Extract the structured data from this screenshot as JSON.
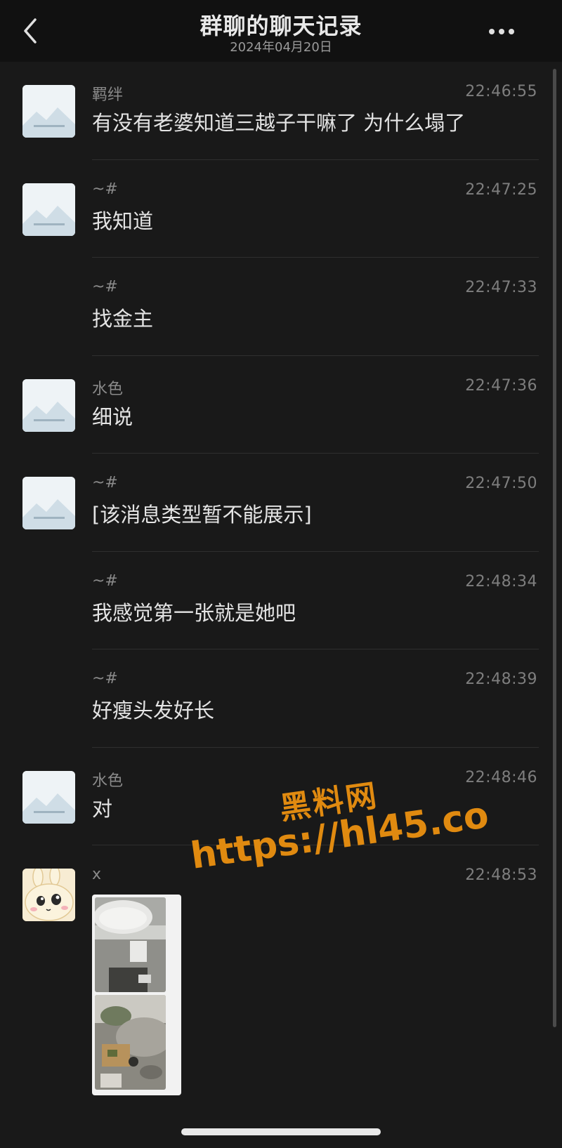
{
  "header": {
    "title": "群聊的聊天记录",
    "date": "2024年04月20日",
    "back_icon": "chevron-left-icon",
    "more_icon": "more-dots-icon"
  },
  "messages": [
    {
      "sender": "羁绊",
      "time": "22:46:55",
      "text": "有没有老婆知道三越子干嘛了 为什么塌了",
      "avatar": "placeholder-image"
    },
    {
      "sender": "~#",
      "time": "22:47:25",
      "text": "我知道",
      "avatar": "placeholder-image"
    },
    {
      "sender": "~#",
      "time": "22:47:33",
      "text": "找金主",
      "avatar": "none"
    },
    {
      "sender": "水色",
      "time": "22:47:36",
      "text": "细说",
      "avatar": "placeholder-image"
    },
    {
      "sender": "~#",
      "time": "22:47:50",
      "text": "[该消息类型暂不能展示]",
      "avatar": "placeholder-image"
    },
    {
      "sender": "~#",
      "time": "22:48:34",
      "text": "我感觉第一张就是她吧",
      "avatar": "none"
    },
    {
      "sender": "~#",
      "time": "22:48:39",
      "text": "好瘦头发好长",
      "avatar": "none"
    },
    {
      "sender": "水色",
      "time": "22:48:46",
      "text": "对",
      "avatar": "placeholder-image"
    },
    {
      "sender": "x",
      "time": "22:48:53",
      "text": "",
      "avatar": "cartoon-bunny",
      "attachment": "image-collage"
    }
  ],
  "watermark": {
    "line1": "黑料网",
    "line2": "https://hl45.co"
  },
  "colors": {
    "background": "#191919",
    "header": "#111111",
    "watermark": "#e08a10"
  }
}
